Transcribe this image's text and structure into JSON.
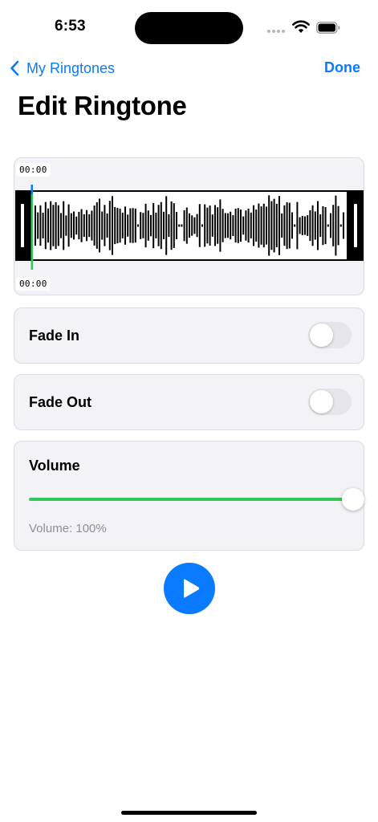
{
  "status": {
    "time": "6:53",
    "icons": [
      "signal-dots-icon",
      "wifi-icon",
      "battery-icon"
    ]
  },
  "nav": {
    "back_label": "My Ringtones",
    "back_icon": "chevron-left-icon",
    "done_label": "Done"
  },
  "page": {
    "title": "Edit Ringtone"
  },
  "waveform": {
    "start_time": "00:00",
    "end_time": "00:00",
    "playhead_color": "#34c759"
  },
  "fade_in": {
    "label": "Fade In",
    "enabled": false
  },
  "fade_out": {
    "label": "Fade Out",
    "enabled": false
  },
  "volume": {
    "label": "Volume",
    "value": 1.0,
    "caption": "Volume: 100%",
    "fill_color": "#34c759"
  },
  "player": {
    "play_icon": "play-icon",
    "accent": "#0a7aff"
  }
}
